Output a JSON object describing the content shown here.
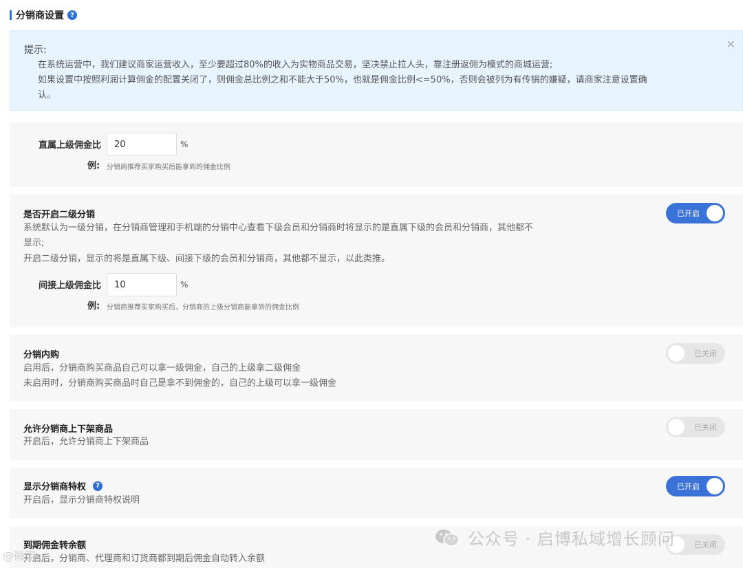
{
  "section": {
    "title": "分销商设置"
  },
  "notice": {
    "title": "提示:",
    "lines": [
      "在系统运营中，我们建议商家运营收入，至少要超过80%的收入为实物商品交易，坚决禁止拉人头，靠注册返佣为模式的商城运营;",
      "如果设置中按照利润计算佣金的配置关闭了，则佣金总比例之和不能大于50%，也就是佣金比例<=50%，否则会被列为有传销的嫌疑，请商家注意设置确",
      "认。"
    ]
  },
  "direct": {
    "label_line1": "直属上级佣金比",
    "label_line2": "例:",
    "value": "20",
    "unit": "%",
    "help": "分销商推荐买家购买后能拿到的佣金比例"
  },
  "level2": {
    "title": "是否开启二级分销",
    "desc": [
      "系统默认为一级分销，在分销商管理和手机端的分销中心查看下级会员和分销商时将显示的是直属下级的会员和分销商，其他都不",
      "显示;",
      "开启二级分销，显示的将是直属下级、间接下级的会员和分销商，其他都不显示，以此类推。"
    ],
    "switch_label": "已开启",
    "field": {
      "label_line1": "间接上级佣金比",
      "label_line2": "例:",
      "value": "10",
      "unit": "%",
      "help": "分销商推荐买家购买后，分销商的上级分销商能拿到的佣金比例"
    }
  },
  "inner": {
    "title": "分销内购",
    "desc": [
      "启用后，分销商购买商品自己可以拿一级佣金，自己的上级拿二级佣金",
      "未启用时，分销商购买商品时自己是拿不到佣金的，自己的上级可以拿一级佣金"
    ],
    "switch_label": "已关闭"
  },
  "shelf": {
    "title": "允许分销商上下架商品",
    "desc": [
      "开启后，允许分销商上下架商品"
    ],
    "switch_label": "已关闭"
  },
  "privilege": {
    "title": "显示分销商特权",
    "desc": [
      "开启后，显示分销商特权说明"
    ],
    "switch_label": "已开启"
  },
  "expire": {
    "title": "到期佣金转余额",
    "desc": [
      "开启后，分销商、代理商和订货商都到期后佣金自动转入余额"
    ],
    "switch_label": "已关闭"
  },
  "watermark": {
    "text": "公众号 · 启博私域增长顾问",
    "text2": "@微盟"
  },
  "colors": {
    "accent": "#3a72d8",
    "notice_bg": "#e8f4fd",
    "card_bg": "#f7f7f7"
  }
}
